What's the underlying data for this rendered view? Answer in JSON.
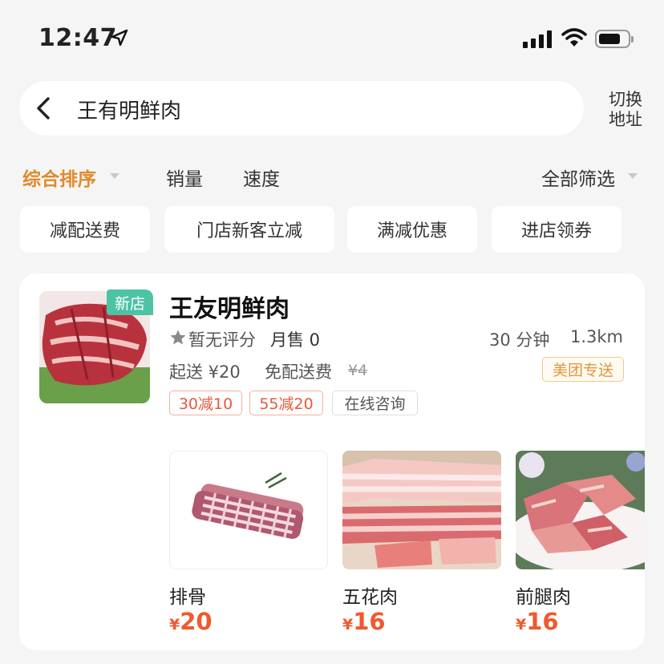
{
  "status_bar": {
    "time": "12:47"
  },
  "search": {
    "query": "王有明鲜肉",
    "switch_address": "切换\n地址"
  },
  "sort_bar": {
    "items": [
      {
        "label": "综合排序"
      },
      {
        "label": "销量"
      },
      {
        "label": "速度"
      }
    ],
    "filter": "全部筛选"
  },
  "chips": [
    "减配送费",
    "门店新客立减",
    "满减优惠",
    "进店领券"
  ],
  "store": {
    "badge": "新店",
    "name": "王友明鲜肉",
    "rating": "暂无评分",
    "monthly_sales": "月售 0",
    "delivery_time": "30 分钟",
    "distance": "1.3km",
    "min_order": "起送 ¥20",
    "delivery_fee": "免配送费",
    "original_fee": "¥4",
    "delivery_badge": "美团专送",
    "promos": [
      "30减10",
      "55减20"
    ],
    "consult": "在线咨询"
  },
  "products": [
    {
      "name": "排骨",
      "currency": "¥",
      "price": "20"
    },
    {
      "name": "五花肉",
      "currency": "¥",
      "price": "16"
    },
    {
      "name": "前腿肉",
      "currency": "¥",
      "price": "16"
    }
  ],
  "colors": {
    "accent_orange": "#e08a2c",
    "price_red": "#f0592f",
    "new_tag_green": "#4cc3a5",
    "background": "#f5f5f5"
  },
  "icons": [
    "location-arrow-icon",
    "signal-icon",
    "wifi-icon",
    "battery-icon",
    "back-arrow-icon",
    "star-icon",
    "caret-down-icon"
  ]
}
